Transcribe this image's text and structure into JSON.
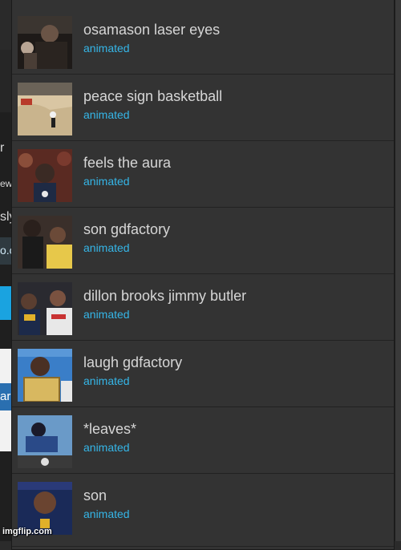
{
  "background_fragments": [
    "r",
    "ew",
    "sly",
    "o.c",
    "ar"
  ],
  "items": [
    {
      "title": "osamason laser eyes",
      "type": "animated"
    },
    {
      "title": "peace sign basketball",
      "type": "animated"
    },
    {
      "title": "feels the aura",
      "type": "animated"
    },
    {
      "title": "son gdfactory",
      "type": "animated"
    },
    {
      "title": "dillon brooks jimmy butler",
      "type": "animated"
    },
    {
      "title": "laugh gdfactory",
      "type": "animated"
    },
    {
      "title": "*leaves*",
      "type": "animated"
    },
    {
      "title": "son",
      "type": "animated"
    }
  ],
  "watermark": "imgflip.com",
  "colors": {
    "panel": "#333333",
    "subtitle": "#35b6e8",
    "title": "#d6d6d6"
  }
}
